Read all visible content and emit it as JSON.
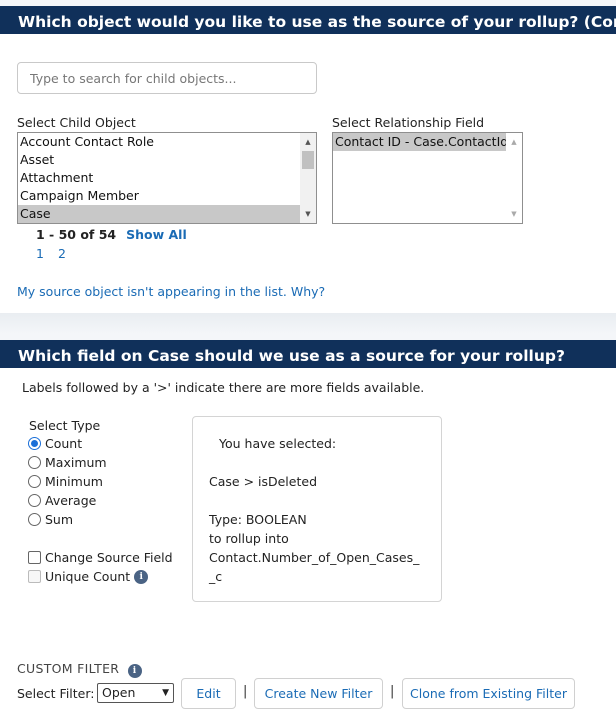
{
  "section1": {
    "title": "Which object would you like to use as the source of your rollup? (Contact Child)",
    "search_placeholder": "Type to search for child objects...",
    "child_object_label": "Select Child Object",
    "child_objects": [
      "Account Contact Role",
      "Asset",
      "Attachment",
      "Campaign Member",
      "Case"
    ],
    "selected_child_object": "Case",
    "relationship_label": "Select Relationship Field",
    "relationship_fields": [
      "Contact ID - Case.ContactId"
    ],
    "pager_range": "1 - 50 of 54",
    "show_all": "Show All",
    "pages": [
      "1",
      "2"
    ],
    "help_link": "My source object isn't appearing in the list. Why?"
  },
  "section2": {
    "title": "Which field on Case should we use as a source for your rollup?",
    "hint": "Labels followed by a '>' indicate there are more fields available.",
    "select_type_label": "Select Type",
    "types": [
      "Count",
      "Maximum",
      "Minimum",
      "Average",
      "Sum"
    ],
    "selected_type": "Count",
    "change_source_field": "Change Source Field",
    "unique_count": "Unique Count",
    "selection_box": {
      "heading": "You have selected:",
      "field_path": "Case > isDeleted",
      "type_line": "Type: BOOLEAN",
      "rollup_into": "to rollup into",
      "target_1": "Contact.Number_of_Open_Cases_",
      "target_2": "_c"
    }
  },
  "custom_filter": {
    "heading": "CUSTOM FILTER",
    "select_label": "Select Filter:",
    "selected_filter": "Open",
    "edit": "Edit",
    "create_new": "Create New Filter",
    "clone": "Clone from Existing Filter",
    "separator": "|"
  },
  "colors": {
    "header_bg": "#10305a",
    "link": "#1a6bb5",
    "radio_selected": "#1a6fd8"
  }
}
